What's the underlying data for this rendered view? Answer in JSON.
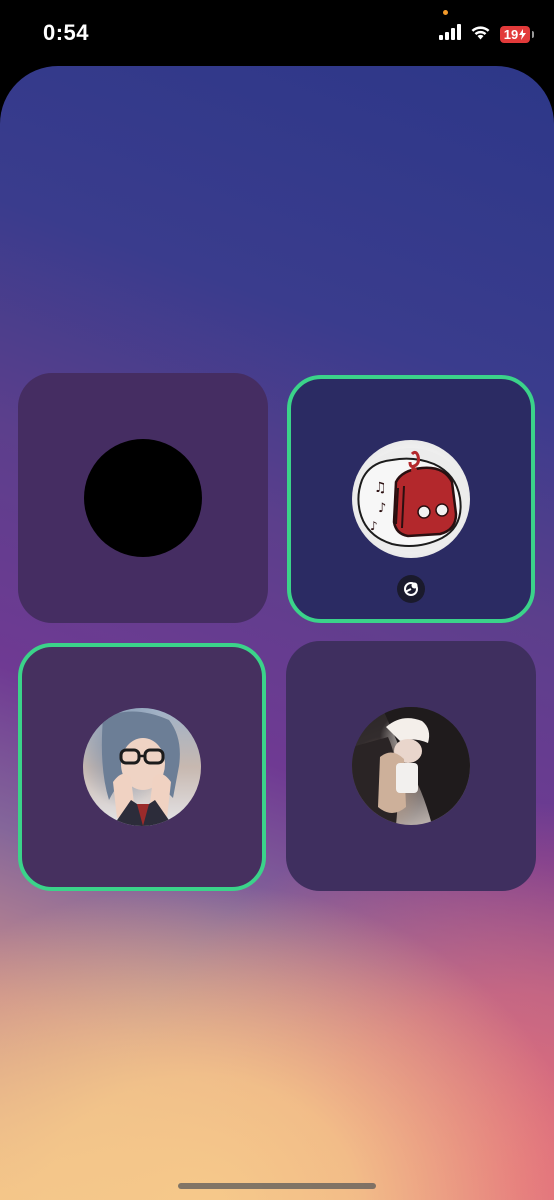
{
  "status_bar": {
    "time": "0:54",
    "battery_level": "19",
    "icons": [
      "cellular-signal-icon",
      "wifi-icon",
      "battery-charging-icon"
    ],
    "privacy_indicator_color": "#f39a2a"
  },
  "call": {
    "participants": [
      {
        "name_visible": false,
        "avatar": "black-circle",
        "speaking": false
      },
      {
        "name_visible": false,
        "avatar": "music-bot-illustration",
        "speaking": true,
        "badge": "screen-share-icon"
      },
      {
        "name_visible": false,
        "avatar": "photo",
        "speaking": true
      },
      {
        "name_visible": false,
        "avatar": "photo",
        "speaking": false
      }
    ],
    "speaking_border_color": "#3bd38a"
  }
}
